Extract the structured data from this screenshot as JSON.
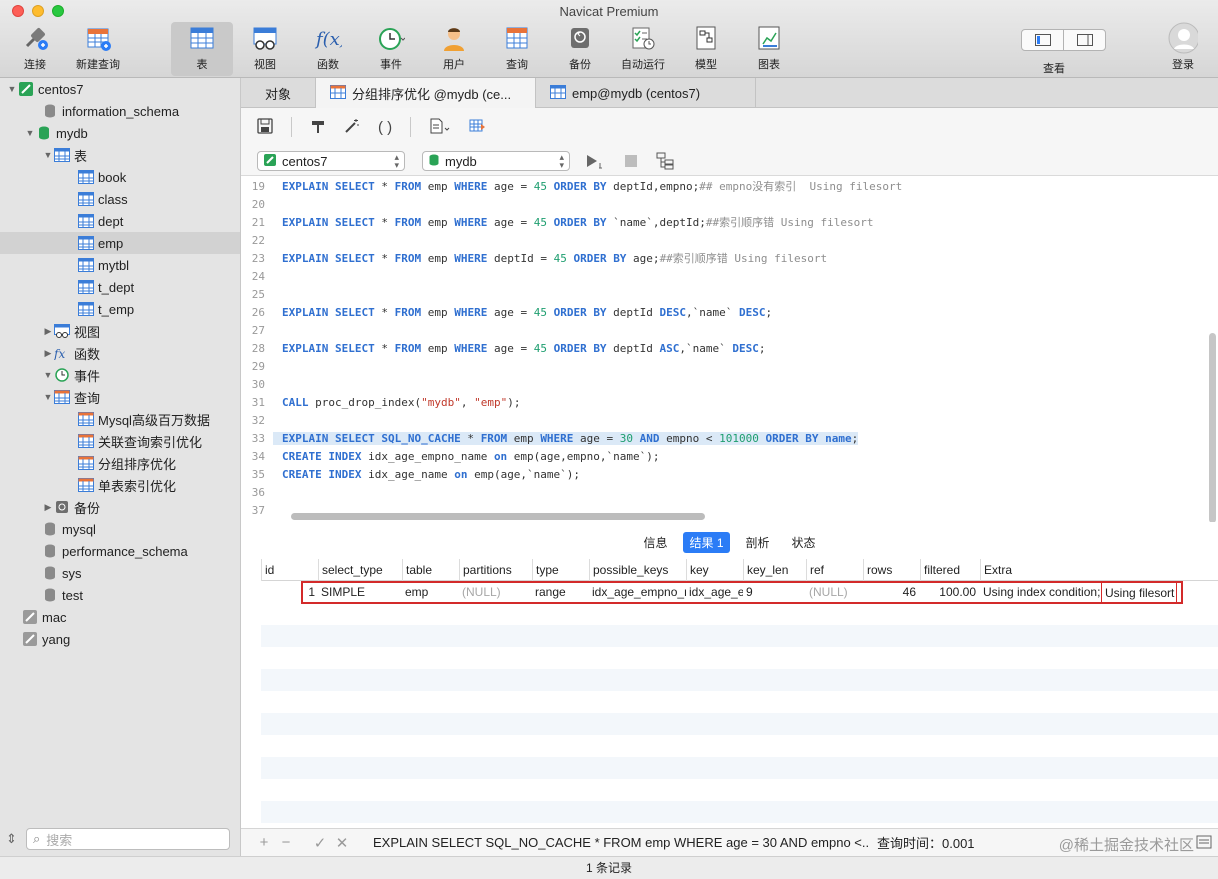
{
  "window": {
    "title": "Navicat Premium"
  },
  "toolbar": {
    "items": [
      {
        "label": "连接"
      },
      {
        "label": "新建查询"
      },
      {
        "label": "表"
      },
      {
        "label": "视图"
      },
      {
        "label": "函数"
      },
      {
        "label": "事件"
      },
      {
        "label": "用户"
      },
      {
        "label": "查询"
      },
      {
        "label": "备份"
      },
      {
        "label": "自动运行"
      },
      {
        "label": "模型"
      },
      {
        "label": "图表"
      }
    ],
    "view_label": "查看",
    "login_label": "登录"
  },
  "sidebar": {
    "items": [
      {
        "label": "centos7"
      },
      {
        "label": "information_schema"
      },
      {
        "label": "mydb"
      },
      {
        "label": "表"
      },
      {
        "label": "book"
      },
      {
        "label": "class"
      },
      {
        "label": "dept"
      },
      {
        "label": "emp"
      },
      {
        "label": "mytbl"
      },
      {
        "label": "t_dept"
      },
      {
        "label": "t_emp"
      },
      {
        "label": "视图"
      },
      {
        "label": "函数"
      },
      {
        "label": "事件"
      },
      {
        "label": "查询"
      },
      {
        "label": "Mysql高级百万数据"
      },
      {
        "label": "关联查询索引优化"
      },
      {
        "label": "分组排序优化"
      },
      {
        "label": "单表索引优化"
      },
      {
        "label": "备份"
      },
      {
        "label": "mysql"
      },
      {
        "label": "performance_schema"
      },
      {
        "label": "sys"
      },
      {
        "label": "test"
      },
      {
        "label": "mac"
      },
      {
        "label": "yang"
      }
    ],
    "search_placeholder": "搜索"
  },
  "tabs": [
    {
      "label": "对象"
    },
    {
      "label": "分组排序优化 @mydb (ce..."
    },
    {
      "label": "emp@mydb (centos7)"
    }
  ],
  "selectors": {
    "connection": "centos7",
    "database": "mydb"
  },
  "editor": {
    "lines": [
      {
        "n": "19",
        "tokens": [
          [
            "kw",
            "EXPLAIN SELECT"
          ],
          [
            "t",
            " * "
          ],
          [
            "kw",
            "FROM"
          ],
          [
            "t",
            " emp "
          ],
          [
            "kw",
            "WHERE"
          ],
          [
            "t",
            " age = "
          ],
          [
            "num",
            "45"
          ],
          [
            "t",
            " "
          ],
          [
            "kw",
            "ORDER BY"
          ],
          [
            "t",
            " deptId,empno;"
          ],
          [
            "cm",
            "## empno没有索引  Using filesort"
          ]
        ]
      },
      {
        "n": "20",
        "tokens": []
      },
      {
        "n": "21",
        "tokens": [
          [
            "kw",
            "EXPLAIN SELECT"
          ],
          [
            "t",
            " * "
          ],
          [
            "kw",
            "FROM"
          ],
          [
            "t",
            " emp "
          ],
          [
            "kw",
            "WHERE"
          ],
          [
            "t",
            " age = "
          ],
          [
            "num",
            "45"
          ],
          [
            "t",
            " "
          ],
          [
            "kw",
            "ORDER BY"
          ],
          [
            "t",
            " `name`,deptId;"
          ],
          [
            "cm",
            "##索引顺序错 Using filesort"
          ]
        ]
      },
      {
        "n": "22",
        "tokens": []
      },
      {
        "n": "23",
        "tokens": [
          [
            "kw",
            "EXPLAIN SELECT"
          ],
          [
            "t",
            " * "
          ],
          [
            "kw",
            "FROM"
          ],
          [
            "t",
            " emp "
          ],
          [
            "kw",
            "WHERE"
          ],
          [
            "t",
            " deptId = "
          ],
          [
            "num",
            "45"
          ],
          [
            "t",
            " "
          ],
          [
            "kw",
            "ORDER BY"
          ],
          [
            "t",
            " age;"
          ],
          [
            "cm",
            "##索引顺序错 Using filesort"
          ]
        ]
      },
      {
        "n": "24",
        "tokens": []
      },
      {
        "n": "25",
        "tokens": []
      },
      {
        "n": "26",
        "tokens": [
          [
            "kw",
            "EXPLAIN SELECT"
          ],
          [
            "t",
            " * "
          ],
          [
            "kw",
            "FROM"
          ],
          [
            "t",
            " emp "
          ],
          [
            "kw",
            "WHERE"
          ],
          [
            "t",
            " age = "
          ],
          [
            "num",
            "45"
          ],
          [
            "t",
            " "
          ],
          [
            "kw",
            "ORDER BY"
          ],
          [
            "t",
            " deptId "
          ],
          [
            "kw",
            "DESC"
          ],
          [
            "t",
            ",`name` "
          ],
          [
            "kw",
            "DESC"
          ],
          [
            "t",
            ";"
          ]
        ]
      },
      {
        "n": "27",
        "tokens": []
      },
      {
        "n": "28",
        "tokens": [
          [
            "kw",
            "EXPLAIN SELECT"
          ],
          [
            "t",
            " * "
          ],
          [
            "kw",
            "FROM"
          ],
          [
            "t",
            " emp "
          ],
          [
            "kw",
            "WHERE"
          ],
          [
            "t",
            " age = "
          ],
          [
            "num",
            "45"
          ],
          [
            "t",
            " "
          ],
          [
            "kw",
            "ORDER BY"
          ],
          [
            "t",
            " deptId "
          ],
          [
            "kw",
            "ASC"
          ],
          [
            "t",
            ",`name` "
          ],
          [
            "kw",
            "DESC"
          ],
          [
            "t",
            ";"
          ]
        ]
      },
      {
        "n": "29",
        "tokens": []
      },
      {
        "n": "30",
        "tokens": []
      },
      {
        "n": "31",
        "tokens": [
          [
            "kw",
            "CALL"
          ],
          [
            "t",
            " proc_drop_index("
          ],
          [
            "str",
            "\"mydb\""
          ],
          [
            "t",
            ", "
          ],
          [
            "str",
            "\"emp\""
          ],
          [
            "t",
            ");"
          ]
        ]
      },
      {
        "n": "32",
        "tokens": []
      },
      {
        "n": "33",
        "hl": true,
        "tokens": [
          [
            "kw",
            "EXPLAIN SELECT SQL_NO_CACHE"
          ],
          [
            "t",
            " * "
          ],
          [
            "kw",
            "FROM"
          ],
          [
            "t",
            " emp "
          ],
          [
            "kw",
            "WHERE"
          ],
          [
            "t",
            " age = "
          ],
          [
            "num",
            "30"
          ],
          [
            "t",
            " "
          ],
          [
            "kw",
            "AND"
          ],
          [
            "t",
            " empno < "
          ],
          [
            "num",
            "101000"
          ],
          [
            "t",
            " "
          ],
          [
            "kw",
            "ORDER BY"
          ],
          [
            "t",
            " "
          ],
          [
            "kw",
            "name"
          ],
          [
            "t",
            ";"
          ]
        ]
      },
      {
        "n": "34",
        "tokens": [
          [
            "kw",
            "CREATE INDEX"
          ],
          [
            "t",
            " idx_age_empno_name "
          ],
          [
            "kw",
            "on"
          ],
          [
            "t",
            " emp(age,empno,`name`);"
          ]
        ]
      },
      {
        "n": "35",
        "tokens": [
          [
            "kw",
            "CREATE INDEX"
          ],
          [
            "t",
            " idx_age_name "
          ],
          [
            "kw",
            "on"
          ],
          [
            "t",
            " emp(age,`name`);"
          ]
        ]
      },
      {
        "n": "36",
        "tokens": []
      },
      {
        "n": "37",
        "tokens": []
      }
    ]
  },
  "result_tabs": [
    {
      "label": "信息"
    },
    {
      "label": "结果 1"
    },
    {
      "label": "剖析"
    },
    {
      "label": "状态"
    }
  ],
  "grid": {
    "columns": [
      "id",
      "select_type",
      "table",
      "partitions",
      "type",
      "possible_keys",
      "key",
      "key_len",
      "ref",
      "rows",
      "filtered",
      "Extra"
    ],
    "rows": [
      [
        "1",
        "SIMPLE",
        "emp",
        "(NULL)",
        "range",
        "idx_age_empno_n",
        "idx_age_e",
        "9",
        "(NULL)",
        "46",
        "100.00",
        "Using index condition;",
        "Using filesort"
      ]
    ]
  },
  "status": {
    "sql": "EXPLAIN SELECT SQL_NO_CACHE * FROM emp WHERE age = 30 AND empno <...",
    "time": "查询时间：0.001",
    "watermark": "@稀土掘金技术社区"
  },
  "footer": {
    "records": "1 条记录"
  },
  "colors": {
    "accent": "#2b7cf6",
    "keyword": "#2f6fd0",
    "highlight_box": "#d32a2a"
  }
}
